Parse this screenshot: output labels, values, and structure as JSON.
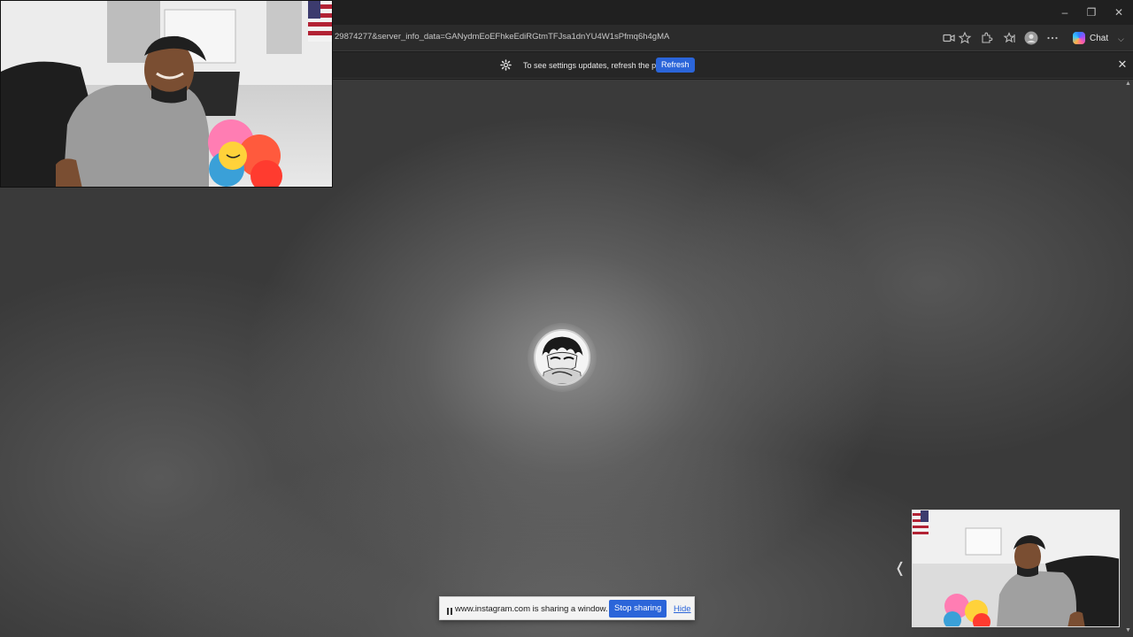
{
  "browser": {
    "url": "29874277&server_info_data=GANydmEoEFhkeEdiRGtmTFJsa1dnYU4W1sPfmq6h4gMA",
    "chat_label": "Chat",
    "window_controls": {
      "minimize": "–",
      "maximize": "❐",
      "close": "✕"
    },
    "toolbar_icons": [
      "camera-icon",
      "star-icon",
      "extensions-icon",
      "favorites-icon",
      "profile-icon",
      "more-icon"
    ]
  },
  "infobar": {
    "message": "To see settings updates, refresh the page",
    "refresh_label": "Refresh",
    "close_glyph": "✕"
  },
  "content": {
    "scroll_up_glyph": "▲",
    "scroll_down_glyph": "▼",
    "side_arrow_glyph": "❬"
  },
  "sharing": {
    "pause_glyph": "II",
    "message": "www.instagram.com is sharing a window.",
    "stop_label": "Stop sharing",
    "hide_label": "Hide"
  },
  "colors": {
    "accent": "#2b65d9",
    "chrome_dark": "#202020",
    "addressbar": "#2b2b2b"
  }
}
